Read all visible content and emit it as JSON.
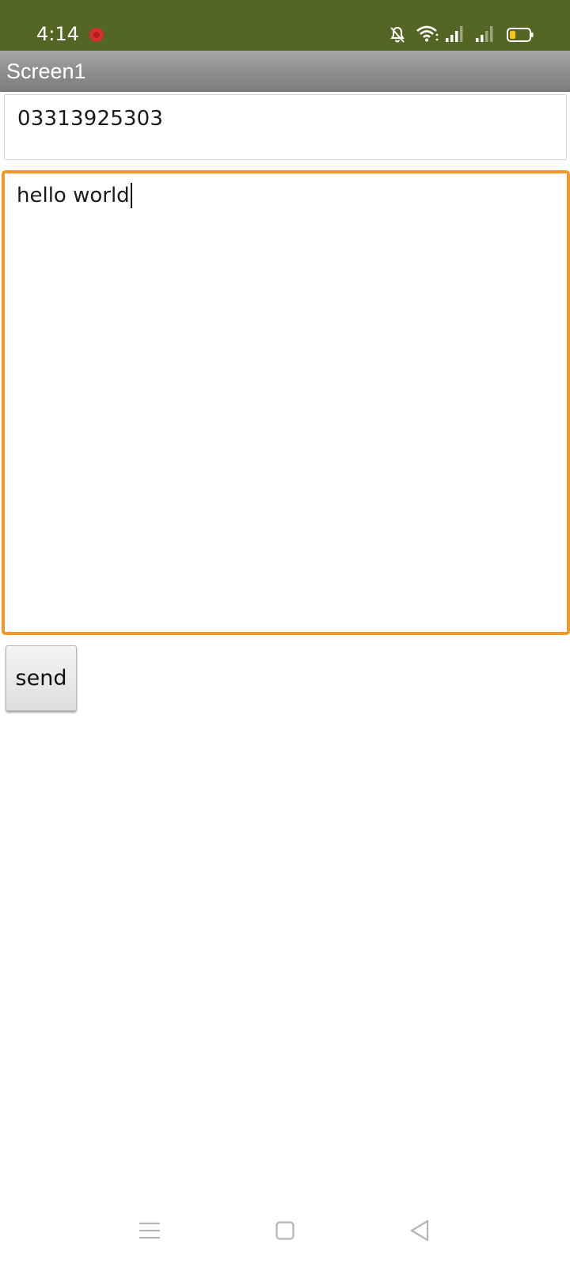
{
  "status_bar": {
    "time": "4:14",
    "icons": [
      "record-icon",
      "notifications-muted-icon",
      "wifi-icon",
      "signal-icon",
      "signal-icon",
      "battery-low-icon"
    ],
    "background_color": "#536624",
    "battery_level_color": "#f5c518"
  },
  "title_bar": {
    "title": "Screen1"
  },
  "form": {
    "phone_value": "03313925303",
    "message_value": "hello world",
    "focus_color": "#f2972a",
    "send_label": "send"
  },
  "nav_bar": {
    "icons": [
      "menu-icon",
      "home-icon",
      "back-icon"
    ]
  }
}
